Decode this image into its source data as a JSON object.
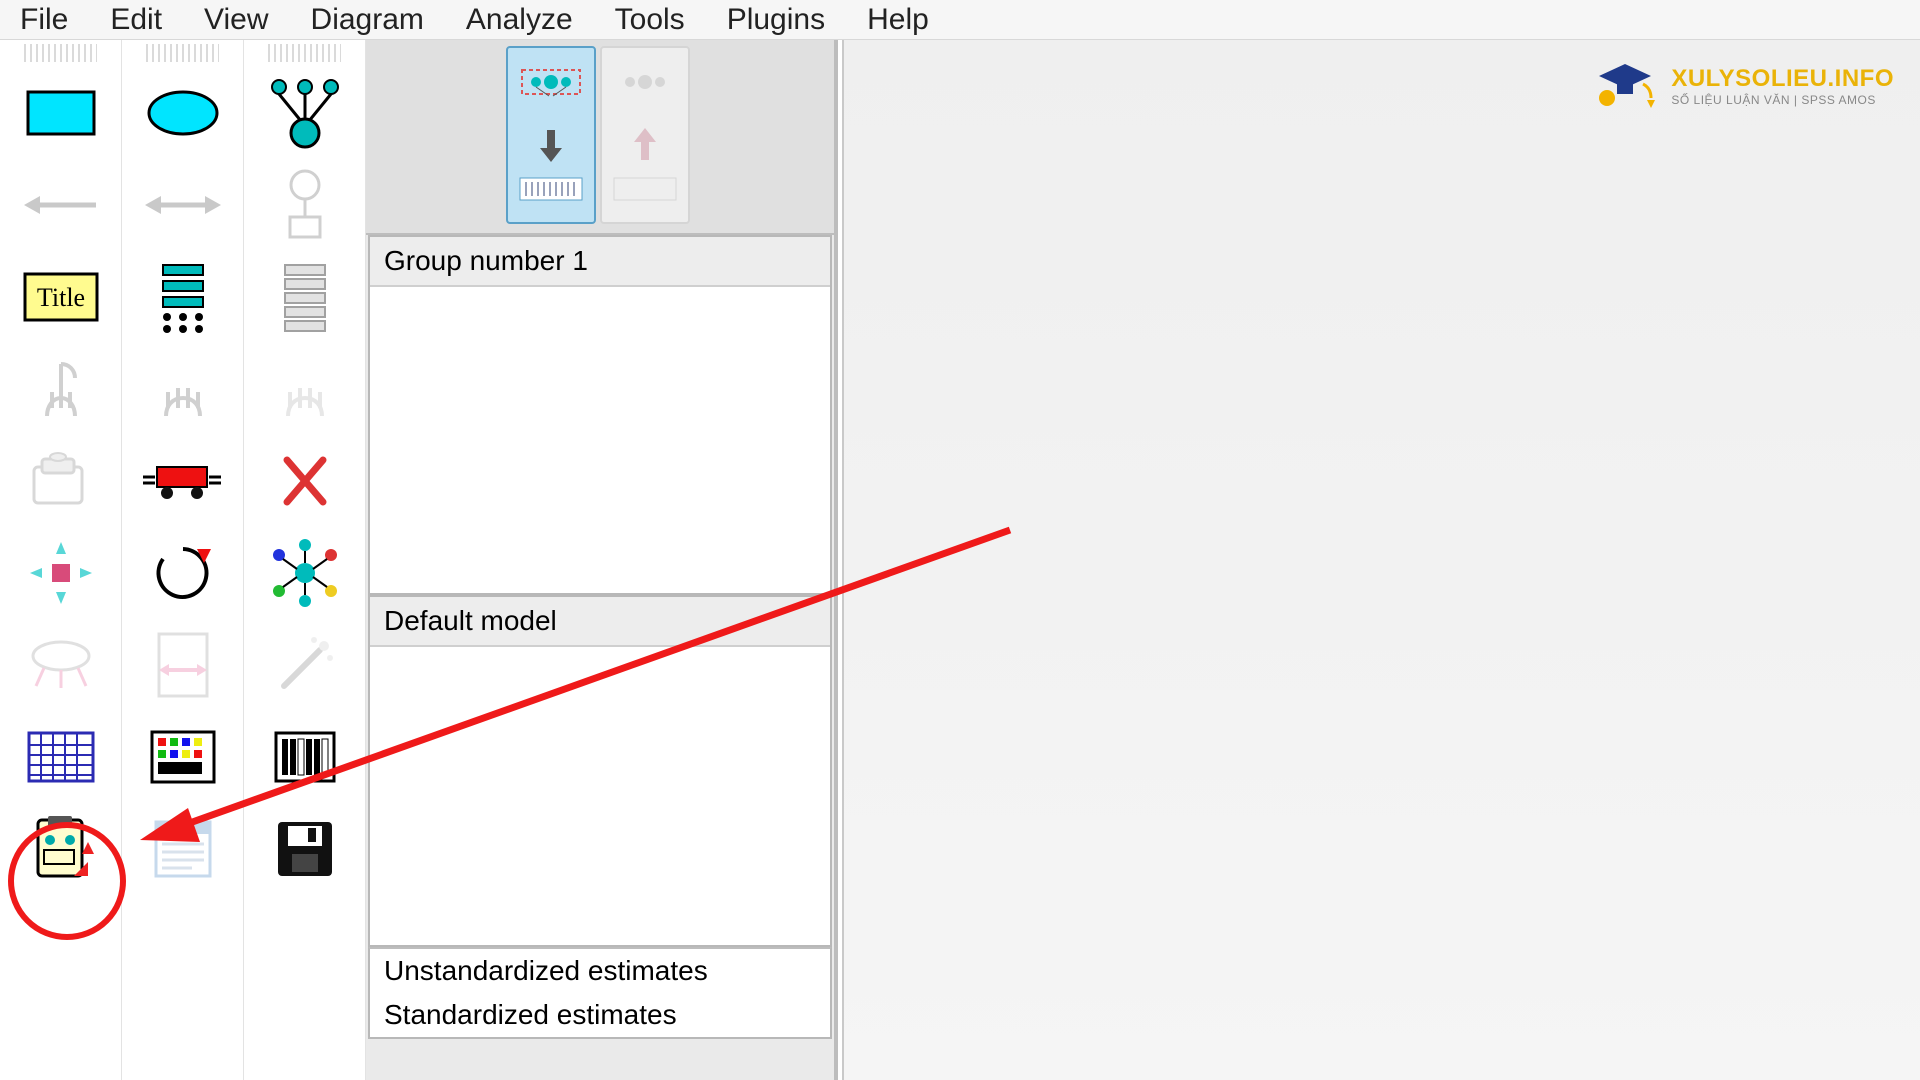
{
  "menu": {
    "file": "File",
    "edit": "Edit",
    "view": "View",
    "diagram": "Diagram",
    "analyze": "Analyze",
    "tools": "Tools",
    "plugins": "Plugins",
    "help": "Help"
  },
  "toolbox": {
    "rect_icon": "observed-variable",
    "ellipse_icon": "latent-variable",
    "indicator_icon": "indicator-variable",
    "arrow_left_icon": "single-arrow",
    "double_arrow_icon": "double-arrow",
    "error_icon": "error-variable",
    "title_label": "Title",
    "list_vars_icon": "variable-list",
    "list_data_icon": "dataset-variable-list",
    "select_one_icon": "select-one",
    "select_all_icon": "select-all",
    "deselect_icon": "deselect-all",
    "copy_icon": "copy-clipboard",
    "truck_icon": "move-object",
    "erase_icon": "erase",
    "resize_icon": "resize-path",
    "rotate_icon": "rotate",
    "reflect_icon": "touch-up",
    "move_param_icon": "move-parameter",
    "fit_page_icon": "resize-page",
    "magic_icon": "magic-wand",
    "datafile_icon": "select-data-file",
    "analysis_prop_icon": "analysis-properties",
    "calc_icon": "calculate-estimates",
    "clipboard_icon": "copy-path-diagram",
    "text_output_icon": "view-text-output",
    "save_icon": "save"
  },
  "thumbs": {
    "input_label": "input-path-diagram",
    "output_label": "output-path-diagram"
  },
  "panels": {
    "group_header": "Group number 1",
    "model_header": "Default model",
    "est_unstd": "Unstandardized estimates",
    "est_std": "Standardized estimates"
  },
  "watermark": {
    "title": "XULYSOLIEU.INFO",
    "subtitle": "SỐ LIỆU LUẬN VĂN | SPSS AMOS"
  }
}
